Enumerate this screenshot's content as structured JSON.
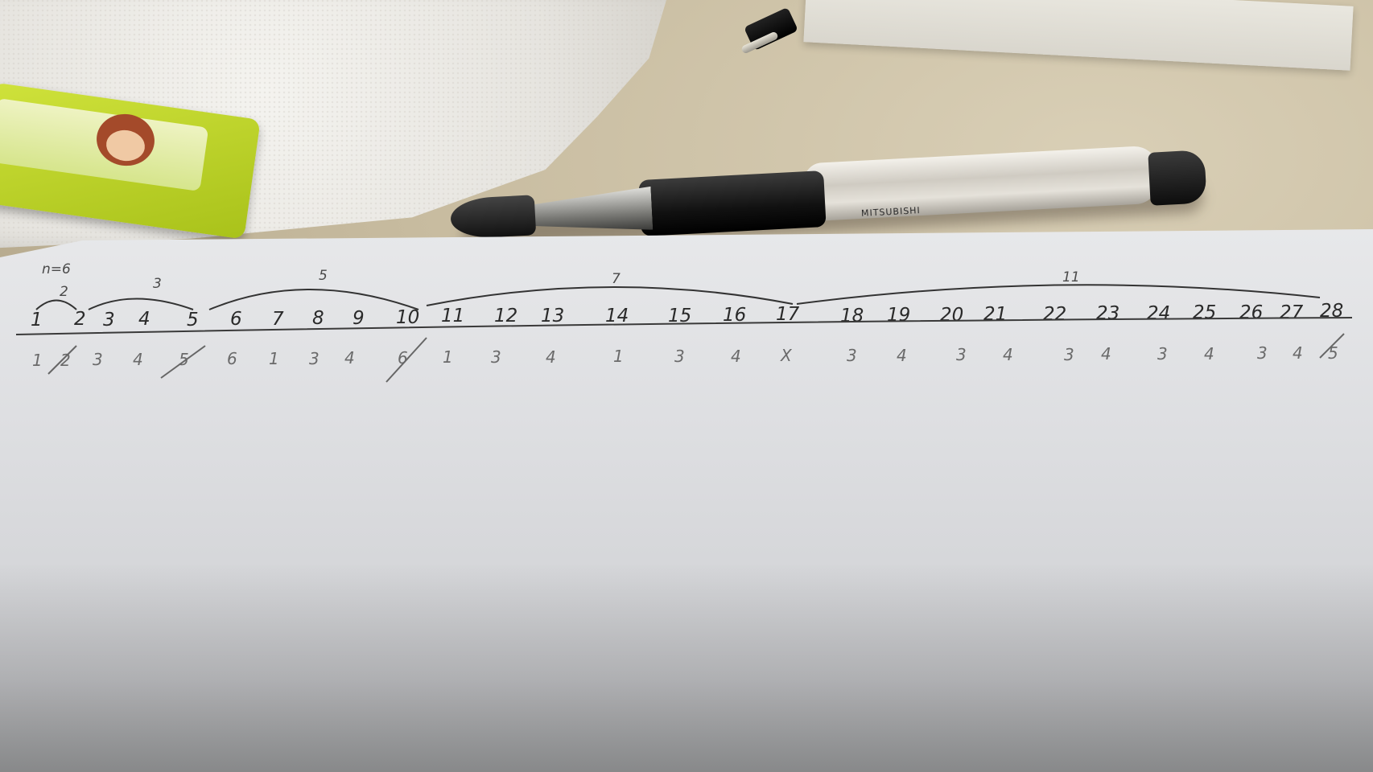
{
  "photo": {
    "objects": {
      "pen_brand": "MITSUBISHI"
    },
    "notes": {
      "heading": "n=6",
      "group_labels": [
        "2",
        "3",
        "5",
        "7",
        "11"
      ],
      "top_row": [
        "1",
        "2",
        "3",
        "4",
        "5",
        "6",
        "7",
        "8",
        "9",
        "10",
        "11",
        "12",
        "13",
        "14",
        "15",
        "16",
        "17",
        "18",
        "19",
        "20",
        "21",
        "22",
        "23",
        "24",
        "25",
        "26",
        "27",
        "28"
      ],
      "bottom_row": [
        "1",
        "2",
        "3",
        "4",
        "5",
        "6",
        "1",
        "3",
        "4",
        "6",
        "1",
        "3",
        "4",
        "1",
        "3",
        "4",
        "X",
        "3",
        "4",
        "3",
        "4",
        "3",
        "4",
        "3",
        "4",
        "3",
        "4",
        "5"
      ]
    }
  }
}
